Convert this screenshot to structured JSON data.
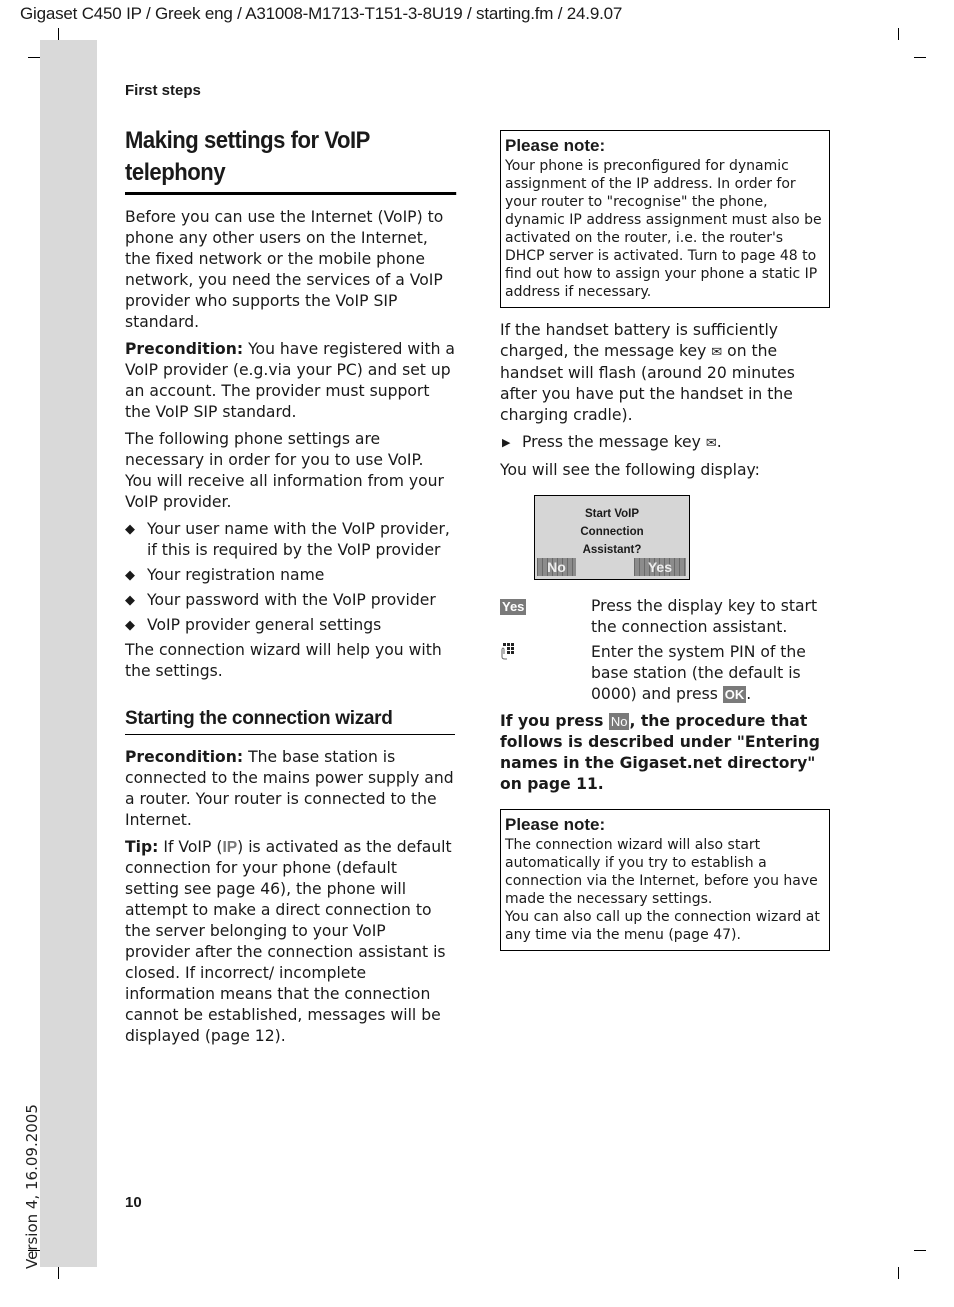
{
  "header": {
    "file_info": "Gigaset C450 IP / Greek eng / A31008-M1713-T151-3-8U19 / starting.fm / 24.9.07",
    "section": "First steps"
  },
  "footer": {
    "page_number": "10",
    "version": "Version 4, 16.09.2005"
  },
  "left": {
    "title": "Making settings for VoIP telephony",
    "intro": "Before you can use the Internet (VoIP) to phone any other users on the Internet, the fixed network or the mobile phone network, you need the services of a VoIP provider who supports the VoIP SIP standard.",
    "precondition1_label": "Precondition:",
    "precondition1_text": " You have registered with a VoIP provider (e.g.via your PC) and set up an account. The provider must support the VoIP SIP standard.",
    "settings_intro": "The following phone settings are necessary in order for you to use VoIP. You will receive all information from your VoIP provider.",
    "bullet_glyph": "◆",
    "bullets": [
      "Your user name with the VoIP provider, if this is required by the VoIP provider",
      "Your registration name",
      "Your password with the VoIP provider",
      "VoIP provider general settings"
    ],
    "wizard_help": "The connection wizard will help you with the settings.",
    "subheading": "Starting the connection wizard",
    "precondition2_label": "Precondition:",
    "precondition2_text": " The base station is connected to the mains power supply and a router. Your router is connected to the Internet.",
    "tip_label": "Tip:",
    "tip_text_1": " If VoIP (",
    "tip_ip": "IP",
    "tip_text_2": ") is activated as the default connection for your phone (default setting see page 46), the phone will attempt to make a direct connection to the server belonging to your VoIP provider after the connection assistant is closed. If incorrect/ incomplete information means that the connection cannot be established, messages will be displayed (page 12)."
  },
  "right": {
    "note1_title": "Please note:",
    "note1_text": "Your phone is preconfigured for dynamic assignment of the IP address. In order for your router to \"recognise\" the phone, dynamic IP address assignment must also be activated on the router, i.e. the router's DHCP server is activated. Turn to page 48 to find out how to assign your phone a static IP address if necessary.",
    "battery_text_1": "If the handset battery is sufficiently charged, the message key ",
    "battery_text_2": " on the handset will flash (around 20 minutes after you have put the handset in the charging cradle).",
    "mail_glyph": "✉",
    "step_arrow": "▶",
    "step_text": "Press the message key ",
    "step_end": ".",
    "display_intro": "You will see the following display:",
    "display": {
      "line1": "Start VoIP",
      "line2": "Connection",
      "line3": "Assistant?",
      "left_key": "No",
      "right_key": "Yes"
    },
    "key_rows": [
      {
        "key": "Yes",
        "desc": "Press the display key to start the connection assistant."
      },
      {
        "key_icon": "keypad-icon",
        "desc_1": "Enter the system PIN of the base station (the default is 0000) and press ",
        "desc_key": "OK",
        "desc_2": "."
      }
    ],
    "no_para_1": "If you press ",
    "no_key": "No",
    "no_para_2": ", the procedure that follows is described under \"Entering names in the Gigaset.net directory\" on page 11.",
    "note2_title": "Please note:",
    "note2_text_1": "The connection wizard will also start automatically if you try to establish a connection via the Internet, before you have made the necessary settings.",
    "note2_text_2": "You can also call up the connection wizard at any time via the menu (page 47)."
  },
  "colors": {
    "sidebar_gray": "#d9d9d9",
    "badge_gray": "#7a7a7a",
    "display_bg": "#d6d6d6"
  }
}
